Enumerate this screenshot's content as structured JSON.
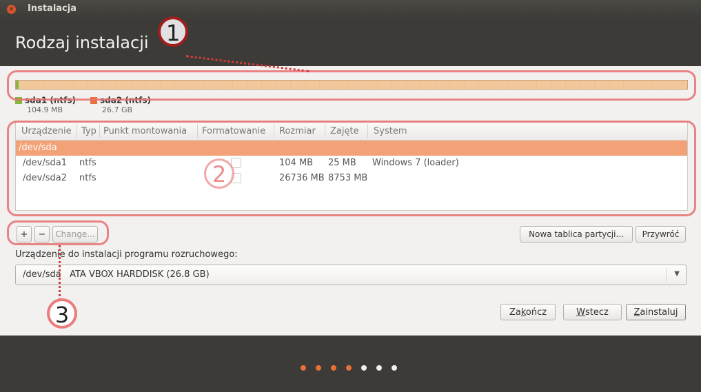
{
  "window": {
    "title": "Instalacja",
    "close_glyph": "×"
  },
  "page": {
    "title": "Rodzaj instalacji"
  },
  "disk_bar": {
    "partitions": [
      {
        "name": "sda1 (ntfs)",
        "size": "104.9 MB",
        "color": "#86b73f"
      },
      {
        "name": "sda2 (ntfs)",
        "size": "26.7 GB",
        "color": "#e86f3a"
      }
    ]
  },
  "table": {
    "headers": [
      "Urządzenie",
      "Typ",
      "Punkt montowania",
      "Formatowanie",
      "Rozmiar",
      "Zajęte",
      "System"
    ],
    "rows": [
      {
        "device": "/dev/sda",
        "type": "",
        "mount": "",
        "size": "",
        "used": "",
        "system": "",
        "selected": true
      },
      {
        "device": "/dev/sda1",
        "type": "ntfs",
        "mount": "",
        "size": "104 MB",
        "used": "25 MB",
        "system": "Windows 7 (loader)",
        "selected": false
      },
      {
        "device": "/dev/sda2",
        "type": "ntfs",
        "mount": "",
        "size": "26736 MB",
        "used": "8753 MB",
        "system": "",
        "selected": false
      }
    ]
  },
  "toolbar": {
    "add_label": "+",
    "remove_label": "−",
    "change_label": "Change...",
    "new_table_label": "Nowa tablica partycji...",
    "revert_label": "Przywróć"
  },
  "bootloader": {
    "label": "Urządzenie do instalacji programu rozruchowego:",
    "device": "/dev/sda",
    "description": "ATA VBOX HARDDISK (26.8 GB)",
    "arrow": "▼"
  },
  "buttons": {
    "quit": {
      "pre": "Za",
      "accel": "k",
      "post": "ończ"
    },
    "back": {
      "pre": "",
      "accel": "W",
      "post": "stecz"
    },
    "install": {
      "pre": "",
      "accel": "Z",
      "post": "ainstaluj"
    }
  },
  "progress": {
    "total_steps": 7,
    "completed_steps": 4
  },
  "annotations": [
    "1",
    "2",
    "3"
  ],
  "colors": {
    "accent": "#e86f3a",
    "selection": "#f3a277",
    "annotation": "#e86e6e"
  }
}
